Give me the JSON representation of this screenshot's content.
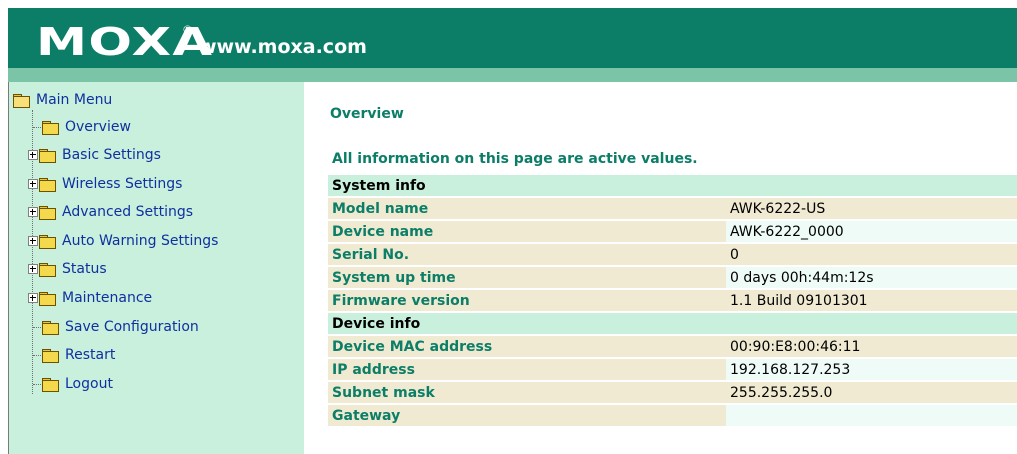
{
  "header": {
    "logo_text": "MOXA",
    "logo_reg": "®",
    "url": "www.moxa.com",
    "brand_color": "#0c7e68"
  },
  "menu": {
    "root": "Main Menu",
    "items": [
      {
        "label": "Overview",
        "expandable": false
      },
      {
        "label": "Basic Settings",
        "expandable": true
      },
      {
        "label": "Wireless Settings",
        "expandable": true
      },
      {
        "label": "Advanced Settings",
        "expandable": true
      },
      {
        "label": "Auto Warning Settings",
        "expandable": true
      },
      {
        "label": "Status",
        "expandable": true
      },
      {
        "label": "Maintenance",
        "expandable": true
      },
      {
        "label": "Save Configuration",
        "expandable": false
      },
      {
        "label": "Restart",
        "expandable": false
      },
      {
        "label": "Logout",
        "expandable": false
      }
    ]
  },
  "main": {
    "title": "Overview",
    "note": "All information on this page are active values.",
    "system_info": {
      "heading": "System info",
      "rows": [
        {
          "label": "Model name",
          "value": "AWK-6222-US"
        },
        {
          "label": "Device name",
          "value": "AWK-6222_0000"
        },
        {
          "label": "Serial No.",
          "value": "0"
        },
        {
          "label": "System up time",
          "value": "0 days 00h:44m:12s"
        },
        {
          "label": "Firmware version",
          "value": "1.1 Build 09101301"
        }
      ]
    },
    "device_info": {
      "heading": "Device info",
      "rows": [
        {
          "label": "Device MAC address",
          "value": "00:90:E8:00:46:11"
        },
        {
          "label": "IP address",
          "value": "192.168.127.253"
        },
        {
          "label": "Subnet mask",
          "value": "255.255.255.0"
        },
        {
          "label": "Gateway",
          "value": ""
        }
      ]
    }
  }
}
